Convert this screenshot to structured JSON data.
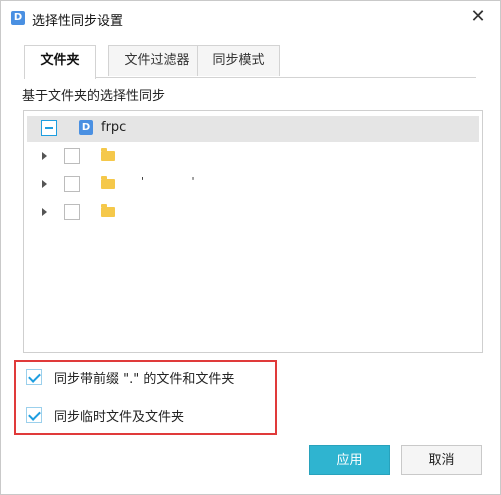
{
  "window": {
    "title": "选择性同步设置",
    "app_icon_letter": "D"
  },
  "tabs": [
    {
      "label": "文件夹",
      "active": true
    },
    {
      "label": "文件过滤器",
      "active": false
    },
    {
      "label": "同步模式",
      "active": false
    }
  ],
  "section_label": "基于文件夹的选择性同步",
  "tree": {
    "root": {
      "label": "frpc",
      "checked": "partial",
      "icon": "sync-drive-icon"
    },
    "children": [
      {
        "label": "",
        "checked": false,
        "icon": "folder-icon"
      },
      {
        "label": "'    '",
        "checked": false,
        "icon": "folder-icon"
      },
      {
        "label": "",
        "checked": false,
        "icon": "folder-icon"
      }
    ]
  },
  "options": [
    {
      "label": "同步带前缀 \".\" 的文件和文件夹",
      "checked": true
    },
    {
      "label": "同步临时文件及文件夹",
      "checked": true
    }
  ],
  "buttons": {
    "apply": "应用",
    "cancel": "取消"
  },
  "colors": {
    "accent": "#2fb4d0",
    "check": "#1e9ee0",
    "highlight": "#e03a3a",
    "folder": "#f5c84a"
  }
}
